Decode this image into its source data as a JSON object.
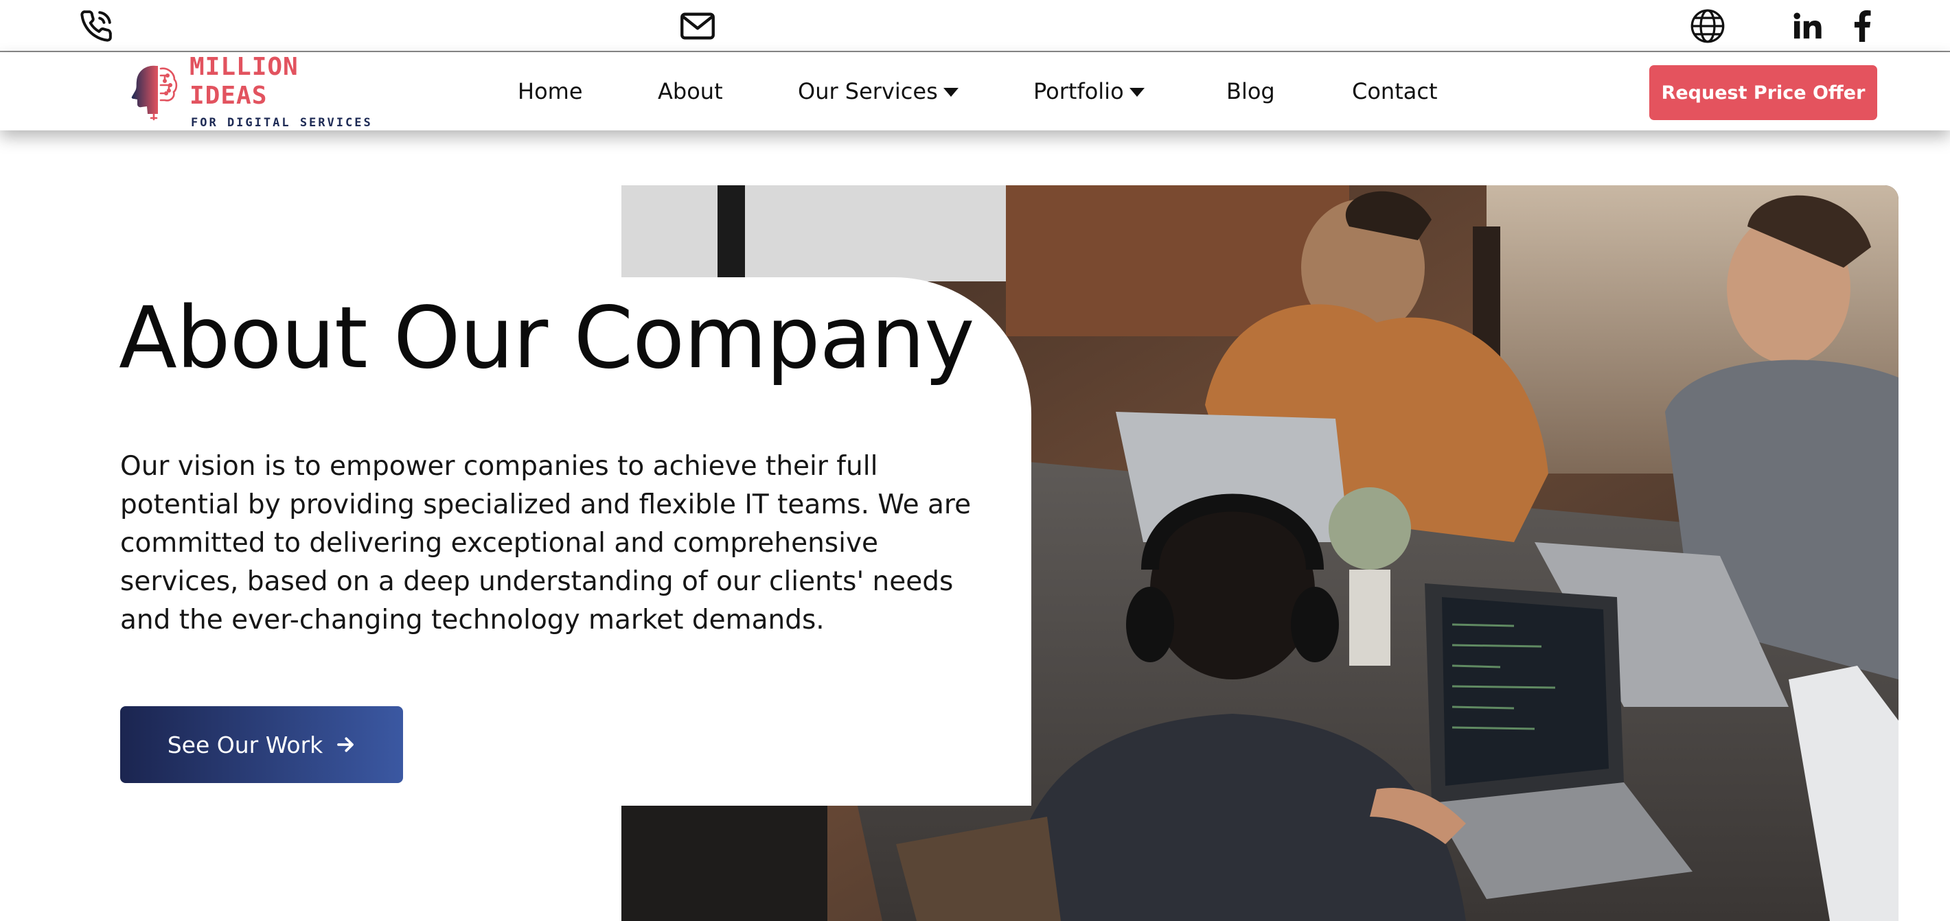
{
  "topbar": {
    "phone_icon": "phone-icon",
    "mail_icon": "mail-icon",
    "language_icon": "globe-icon",
    "linkedin_icon": "linkedin-icon",
    "facebook_icon": "facebook-icon"
  },
  "brand": {
    "title": "MILLION IDEAS",
    "subtitle": "FOR DIGITAL SERVICES",
    "accent_color": "#e4535e",
    "navy_color": "#1e2b55"
  },
  "nav": {
    "items": [
      {
        "label": "Home",
        "dropdown": false
      },
      {
        "label": "About",
        "dropdown": false
      },
      {
        "label": "Our Services",
        "dropdown": true
      },
      {
        "label": "Portfolio",
        "dropdown": true
      },
      {
        "label": "Blog",
        "dropdown": false
      },
      {
        "label": "Contact",
        "dropdown": false
      }
    ],
    "cta_label": "Request Price Offer"
  },
  "hero": {
    "title": "About Our Company",
    "description": "Our vision is to empower companies to achieve their full potential by providing specialized and flexible IT teams. We are committed to delivering exceptional and comprehensive services, based on a deep understanding of our clients' needs and the ever-changing technology market demands.",
    "button_label": "See Our Work",
    "button_icon": "arrow-right-icon",
    "image": "team-working-on-laptops-photo"
  }
}
